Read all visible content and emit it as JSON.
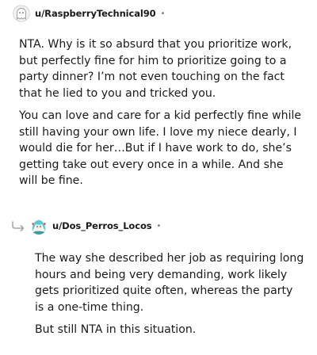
{
  "comments": [
    {
      "username": "u/RaspberryTechnical90",
      "separator": "•",
      "avatar_icon": "default-ghost-avatar-icon",
      "paragraphs": [
        "NTA. Why is it so absurd that you prioritize work, but perfectly fine for him to prioritize going to a party dinner? I’m not even touching on the fact that he lied to you and tricked you.",
        "You can love and care for a kid perfectly fine while still having your own life. I love my niece dearly, I would die for her…But if I have work to do, she’s getting take out every once in a while. And she will be fine."
      ]
    },
    {
      "username": "u/Dos_Perros_Locos",
      "separator": "•",
      "avatar_icon": "anime-character-avatar-icon",
      "reply_icon": "reply-arrow-icon",
      "paragraphs": [
        "The way she described her job as requiring long hours and being very demanding, work likely gets prioritized quite often, whereas the party is a one-time thing.",
        "But still NTA in this situation."
      ]
    }
  ],
  "colors": {
    "text": "#1a1a1b",
    "muted": "#7c7c7c",
    "avatar_teal": "#5ec9cf",
    "background": "#ffffff"
  }
}
